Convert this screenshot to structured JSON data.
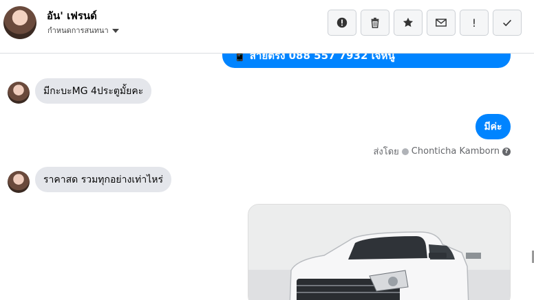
{
  "header": {
    "contact_name": "อัน' เฟรนด์",
    "conversation_settings": "กำหนดการสนทนา",
    "toolbar": {
      "important_icon": "alert-circle-icon",
      "delete_icon": "trash-icon",
      "star_icon": "star-icon",
      "mail_icon": "envelope-icon",
      "flag_label": "!",
      "done_icon": "check-icon"
    }
  },
  "messages": {
    "top_partial_out": "📱 สายตรง 088 557 7932 เจ้หนู",
    "in_1": "มีกะบะMG 4ประตูมั้ยคะ",
    "out_1": "มีค่ะ",
    "sent_by_label": "ส่งโดย",
    "sent_by_name": "Chonticha Kamborn",
    "in_2": "ราคาสด รวมทุกอย่างเท่าไหร่"
  },
  "colors": {
    "outgoing_bubble": "#0084ff",
    "incoming_bubble": "#e4e6eb"
  }
}
